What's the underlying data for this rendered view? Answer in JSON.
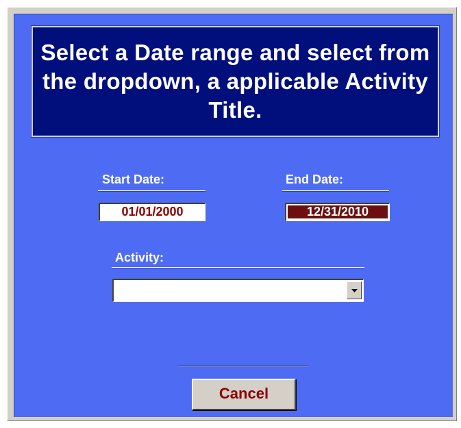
{
  "header": {
    "text": "Select a Date range and select from the dropdown, a applicable Activity Title."
  },
  "start_date": {
    "label": "Start Date:",
    "value": "01/01/2000"
  },
  "end_date": {
    "label": "End Date:",
    "value": "12/31/2010"
  },
  "activity": {
    "label": "Activity:",
    "value": ""
  },
  "buttons": {
    "cancel_label": "Cancel"
  },
  "icons": {
    "dropdown": "chevron-down-icon"
  },
  "colors": {
    "form_background": "#4d6cf3",
    "header_background": "#000f7c",
    "accent_text": "#8b0000",
    "button_face": "#d4d0c8"
  }
}
